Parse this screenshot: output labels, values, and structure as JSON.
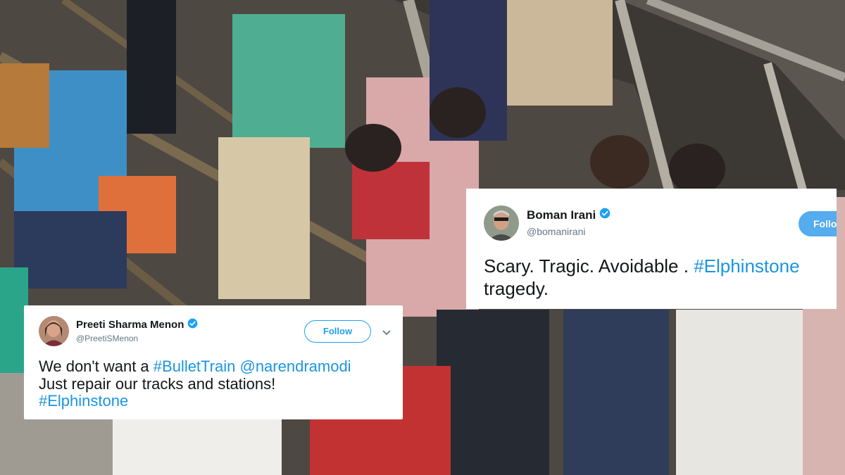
{
  "tweets": [
    {
      "name": "Preeti Sharma Menon",
      "handle": "@PreetiSMenon",
      "follow_label": "Follow",
      "text_parts": {
        "p1": "We don't want a ",
        "t1": "#BulletTrain",
        "p2": " ",
        "t2": "@narendramodi",
        "p3": "Just repair our tracks and stations!",
        "t3": "#Elphinstone"
      },
      "icons": [
        "verified-badge-icon",
        "chevron-down-icon"
      ]
    },
    {
      "name": "Boman Irani",
      "handle": "@bomanirani",
      "follow_label": "Follo",
      "text_parts": {
        "p1": "Scary. Tragic. Avoidable . ",
        "t1": "#Elphinstone",
        "p2": "tragedy."
      },
      "icons": [
        "verified-badge-icon"
      ]
    }
  ],
  "colors": {
    "link": "#1b95e0",
    "verified": "#1da1f2",
    "text": "#14171a",
    "muted": "#657786"
  }
}
